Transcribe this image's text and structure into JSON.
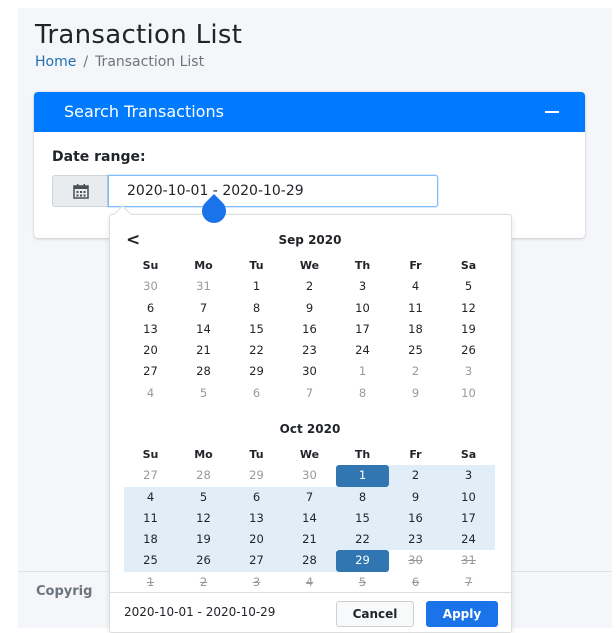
{
  "page": {
    "title": "Transaction List",
    "breadcrumb": {
      "home": "Home",
      "separator": "/",
      "current": "Transaction List"
    }
  },
  "card": {
    "header": "Search Transactions",
    "collapse_icon": "minus-icon",
    "date_label": "Date range:",
    "date_value": "2020-10-01 - 2020-10-29",
    "calendar_icon": "calendar-icon"
  },
  "footer": {
    "text": "Copyrig"
  },
  "picker": {
    "prev_icon": "chevron-left-icon",
    "prev_glyph": "<",
    "weekdays": [
      "Su",
      "Mo",
      "Tu",
      "We",
      "Th",
      "Fr",
      "Sa"
    ],
    "months": [
      {
        "title": "Sep 2020",
        "days": [
          {
            "d": "30",
            "off": true
          },
          {
            "d": "31",
            "off": true
          },
          {
            "d": "1"
          },
          {
            "d": "2"
          },
          {
            "d": "3"
          },
          {
            "d": "4"
          },
          {
            "d": "5"
          },
          {
            "d": "6"
          },
          {
            "d": "7"
          },
          {
            "d": "8"
          },
          {
            "d": "9"
          },
          {
            "d": "10"
          },
          {
            "d": "11"
          },
          {
            "d": "12"
          },
          {
            "d": "13"
          },
          {
            "d": "14"
          },
          {
            "d": "15"
          },
          {
            "d": "16"
          },
          {
            "d": "17"
          },
          {
            "d": "18"
          },
          {
            "d": "19"
          },
          {
            "d": "20"
          },
          {
            "d": "21"
          },
          {
            "d": "22"
          },
          {
            "d": "23"
          },
          {
            "d": "24"
          },
          {
            "d": "25"
          },
          {
            "d": "26"
          },
          {
            "d": "27"
          },
          {
            "d": "28"
          },
          {
            "d": "29"
          },
          {
            "d": "30"
          },
          {
            "d": "1",
            "off": true
          },
          {
            "d": "2",
            "off": true
          },
          {
            "d": "3",
            "off": true
          },
          {
            "d": "4",
            "off": true
          },
          {
            "d": "5",
            "off": true
          },
          {
            "d": "6",
            "off": true
          },
          {
            "d": "7",
            "off": true
          },
          {
            "d": "8",
            "off": true
          },
          {
            "d": "9",
            "off": true
          },
          {
            "d": "10",
            "off": true
          }
        ]
      },
      {
        "title": "Oct 2020",
        "days": [
          {
            "d": "27",
            "off": true
          },
          {
            "d": "28",
            "off": true
          },
          {
            "d": "29",
            "off": true
          },
          {
            "d": "30",
            "off": true
          },
          {
            "d": "1",
            "state": "selected"
          },
          {
            "d": "2",
            "state": "range"
          },
          {
            "d": "3",
            "state": "range"
          },
          {
            "d": "4",
            "state": "range"
          },
          {
            "d": "5",
            "state": "range"
          },
          {
            "d": "6",
            "state": "range"
          },
          {
            "d": "7",
            "state": "range"
          },
          {
            "d": "8",
            "state": "range"
          },
          {
            "d": "9",
            "state": "range"
          },
          {
            "d": "10",
            "state": "range"
          },
          {
            "d": "11",
            "state": "range"
          },
          {
            "d": "12",
            "state": "range"
          },
          {
            "d": "13",
            "state": "range"
          },
          {
            "d": "14",
            "state": "range"
          },
          {
            "d": "15",
            "state": "range"
          },
          {
            "d": "16",
            "state": "range"
          },
          {
            "d": "17",
            "state": "range"
          },
          {
            "d": "18",
            "state": "range"
          },
          {
            "d": "19",
            "state": "range"
          },
          {
            "d": "20",
            "state": "range"
          },
          {
            "d": "21",
            "state": "range"
          },
          {
            "d": "22",
            "state": "range"
          },
          {
            "d": "23",
            "state": "range"
          },
          {
            "d": "24",
            "state": "range"
          },
          {
            "d": "25",
            "state": "range"
          },
          {
            "d": "26",
            "state": "range"
          },
          {
            "d": "27",
            "state": "range"
          },
          {
            "d": "28",
            "state": "range"
          },
          {
            "d": "29",
            "state": "selected"
          },
          {
            "d": "30",
            "struck": true,
            "off": true
          },
          {
            "d": "31",
            "struck": true,
            "off": true
          },
          {
            "d": "1",
            "struck": true,
            "off": true
          },
          {
            "d": "2",
            "struck": true,
            "off": true
          },
          {
            "d": "3",
            "struck": true,
            "off": true
          },
          {
            "d": "4",
            "struck": true,
            "off": true
          },
          {
            "d": "5",
            "struck": true,
            "off": true
          },
          {
            "d": "6",
            "struck": true,
            "off": true
          },
          {
            "d": "7",
            "struck": true,
            "off": true
          }
        ]
      }
    ],
    "range_text": "2020-10-01 - 2020-10-29",
    "cancel_label": "Cancel",
    "apply_label": "Apply"
  },
  "colors": {
    "primary": "#007bff",
    "selected": "#3276b1",
    "in_range": "#e2eef7",
    "apply": "#1a73e8"
  }
}
